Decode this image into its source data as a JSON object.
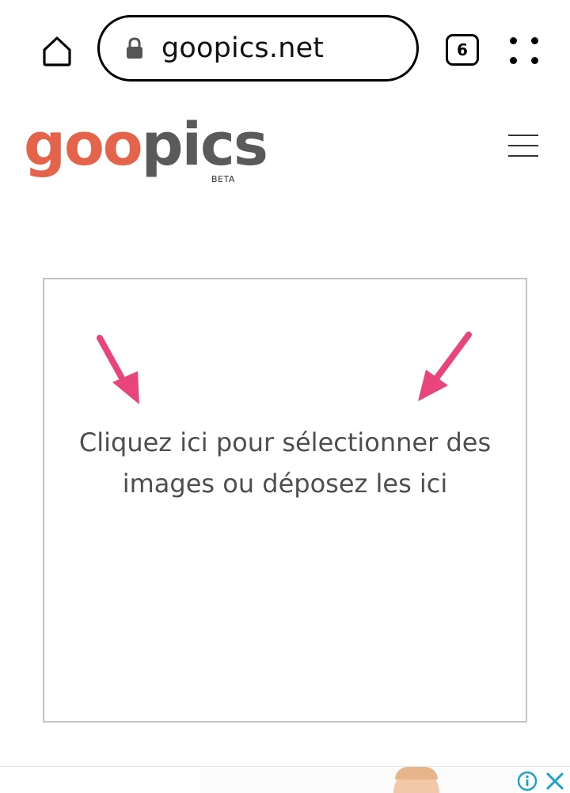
{
  "browser": {
    "url": "goopics.net",
    "tab_count": "6",
    "icons": {
      "home": "home-icon",
      "lock": "lock-icon",
      "menu": "more-vertical-dots-icon"
    }
  },
  "header": {
    "logo_part1": "goo",
    "logo_part2": "pics",
    "logo_badge": "BETA",
    "colors": {
      "logo_accent": "#e4644b",
      "logo_dark": "#5a5a5a"
    },
    "menu_icon": "hamburger-icon"
  },
  "upload": {
    "instruction_line1": "Cliquez ici pour sélectionner des",
    "instruction_line2": "images ou déposez les ici",
    "arrow_color": "#e8457a",
    "icons": [
      "arrow-down-right-icon",
      "arrow-down-left-icon"
    ]
  },
  "ad": {
    "info_icon": "info-icon",
    "close_icon": "close-icon",
    "accent_color": "#1aa3c8"
  }
}
